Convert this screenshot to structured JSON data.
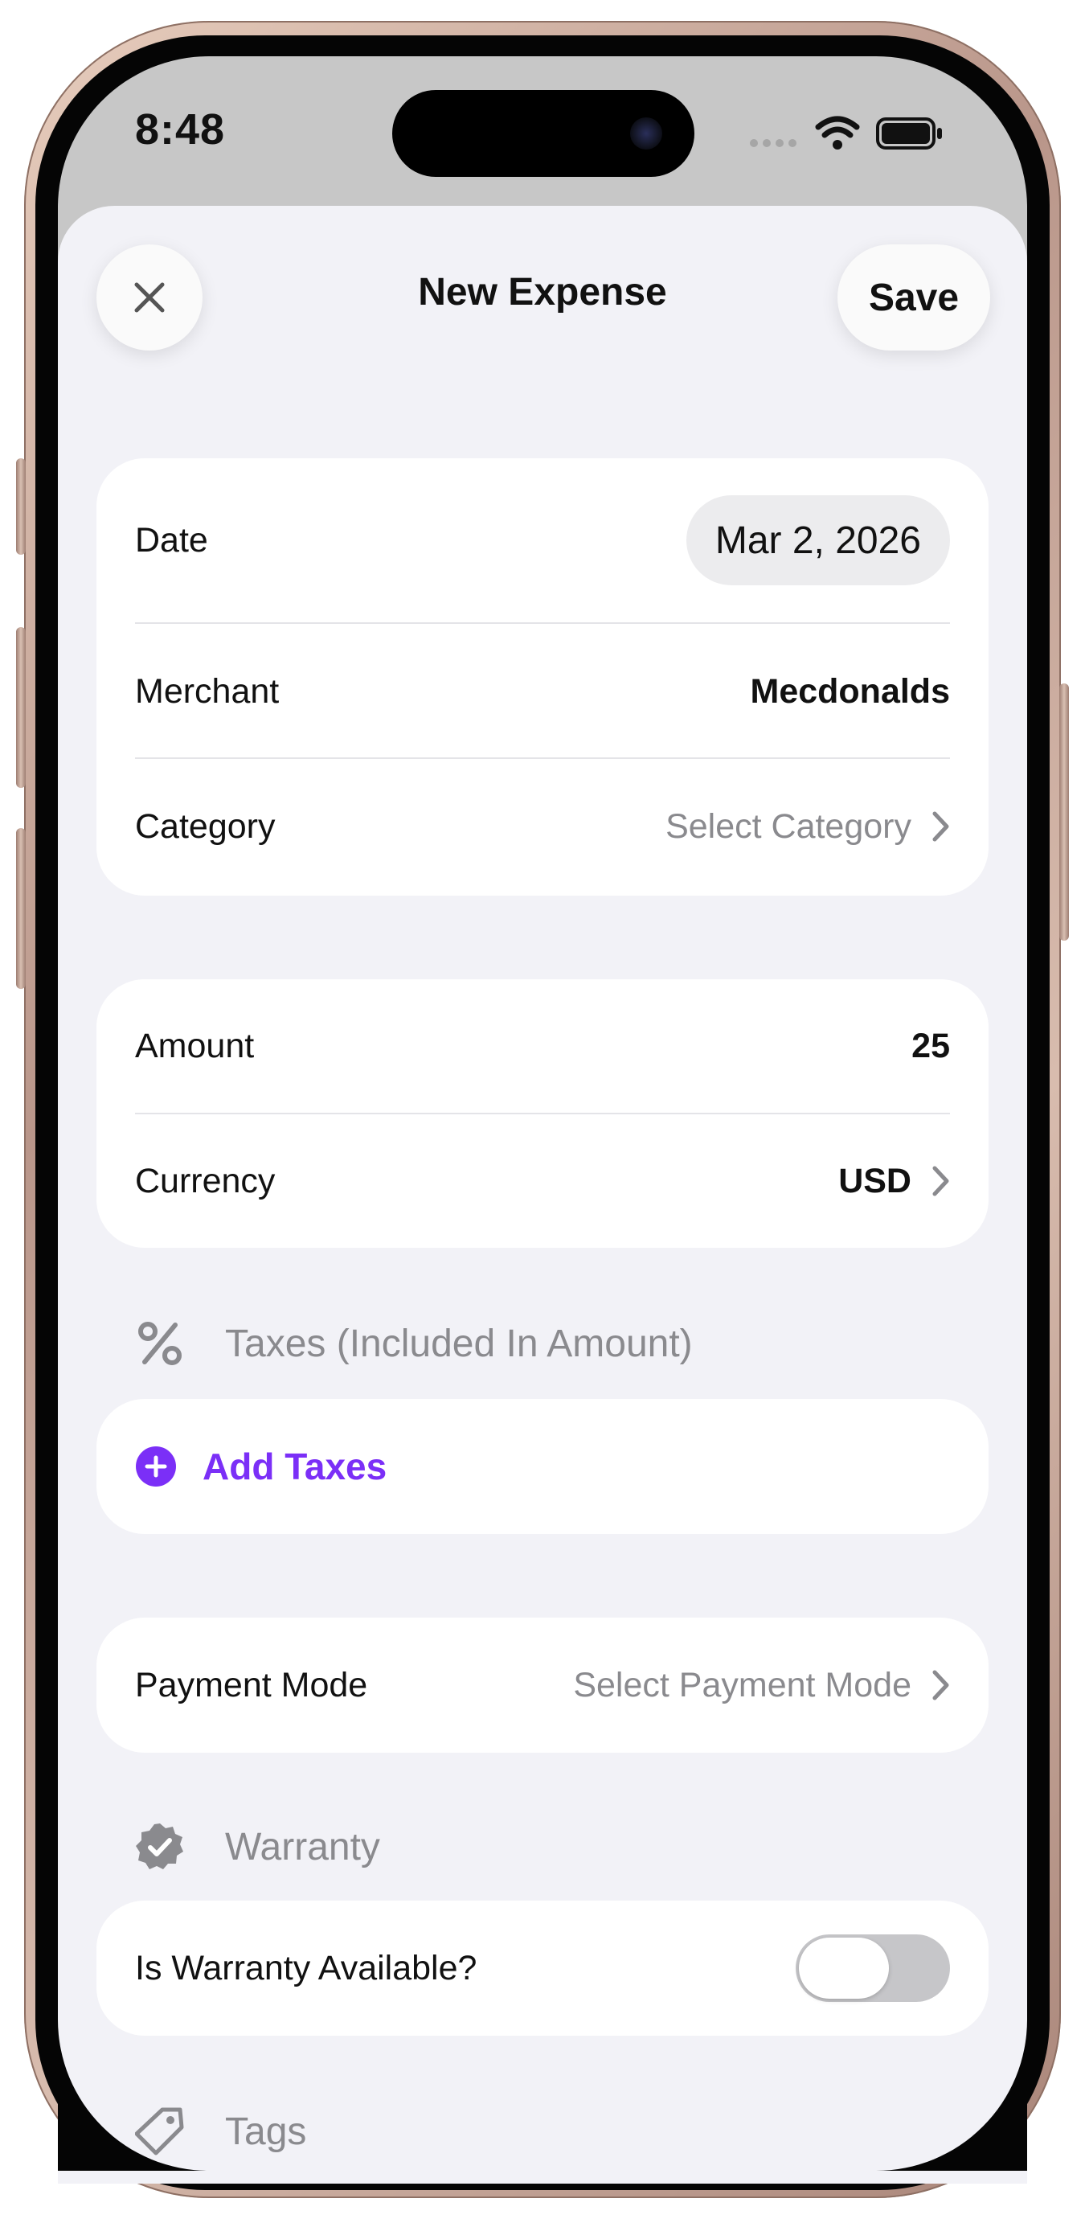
{
  "status_bar": {
    "time": "8:48"
  },
  "nav": {
    "title": "New Expense",
    "save_label": "Save"
  },
  "details": {
    "date_label": "Date",
    "date_value": "Mar 2, 2026",
    "merchant_label": "Merchant",
    "merchant_value": "Mecdonalds",
    "category_label": "Category",
    "category_value": "Select Category"
  },
  "amount_card": {
    "amount_label": "Amount",
    "amount_value": "25",
    "currency_label": "Currency",
    "currency_value": "USD"
  },
  "taxes": {
    "header": "Taxes (Included In Amount)",
    "add_label": "Add Taxes"
  },
  "payment": {
    "label": "Payment Mode",
    "value": "Select Payment Mode"
  },
  "warranty": {
    "header": "Warranty",
    "question": "Is Warranty Available?",
    "enabled": false
  },
  "tags": {
    "header": "Tags"
  },
  "colors": {
    "accent": "#7b2ff7",
    "muted_text": "#8a8a8e",
    "sheet_background": "#f2f2f7"
  },
  "icons": {
    "close": "close-icon",
    "chevron": "chevron-right-icon",
    "percent": "percent-icon",
    "add": "plus-circle-icon",
    "warranty": "verified-badge-icon",
    "tags": "tag-icon"
  }
}
